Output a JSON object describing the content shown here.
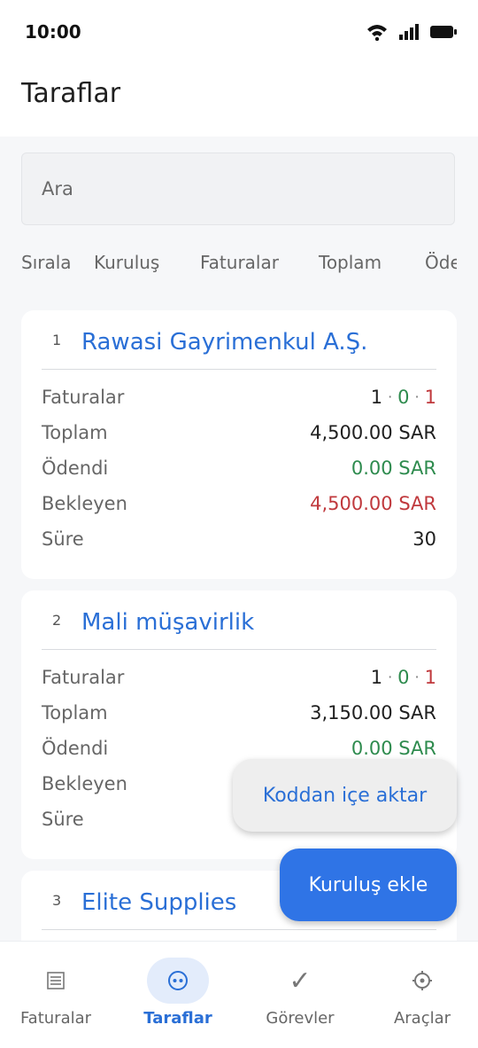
{
  "status": {
    "time": "10:00"
  },
  "header": {
    "title": "Taraflar"
  },
  "search": {
    "placeholder": "Ara"
  },
  "sort": {
    "label": "Sırala",
    "options": [
      "Kuruluş",
      "Faturalar",
      "Toplam",
      "Öde"
    ]
  },
  "labels": {
    "invoices": "Faturalar",
    "total": "Toplam",
    "paid": "Ödendi",
    "pending": "Bekleyen",
    "term": "Süre"
  },
  "parties": [
    {
      "index": "1",
      "name": "Rawasi Gayrimenkul A.Ş.",
      "inv_total": "1",
      "inv_paid": "0",
      "inv_pending": "1",
      "total": "4,500.00 SAR",
      "paid": "0.00 SAR",
      "pending": "4,500.00 SAR",
      "term": "30"
    },
    {
      "index": "2",
      "name": "Mali müşavirlik",
      "inv_total": "1",
      "inv_paid": "0",
      "inv_pending": "1",
      "total": "3,150.00 SAR",
      "paid": "0.00 SAR"
    },
    {
      "index": "3",
      "name": "Elite Supplies"
    }
  ],
  "actions": {
    "import_code": "Koddan içe aktar",
    "add_entity": "Kuruluş ekle"
  },
  "nav": [
    {
      "label": "Faturalar",
      "icon": "list-icon"
    },
    {
      "label": "Taraflar",
      "icon": "parties-icon"
    },
    {
      "label": "Görevler",
      "icon": "check-icon"
    },
    {
      "label": "Araçlar",
      "icon": "gear-icon"
    }
  ],
  "colors": {
    "accent": "#2f74e6",
    "paid": "#2e8b4e",
    "pending": "#c0393d"
  }
}
